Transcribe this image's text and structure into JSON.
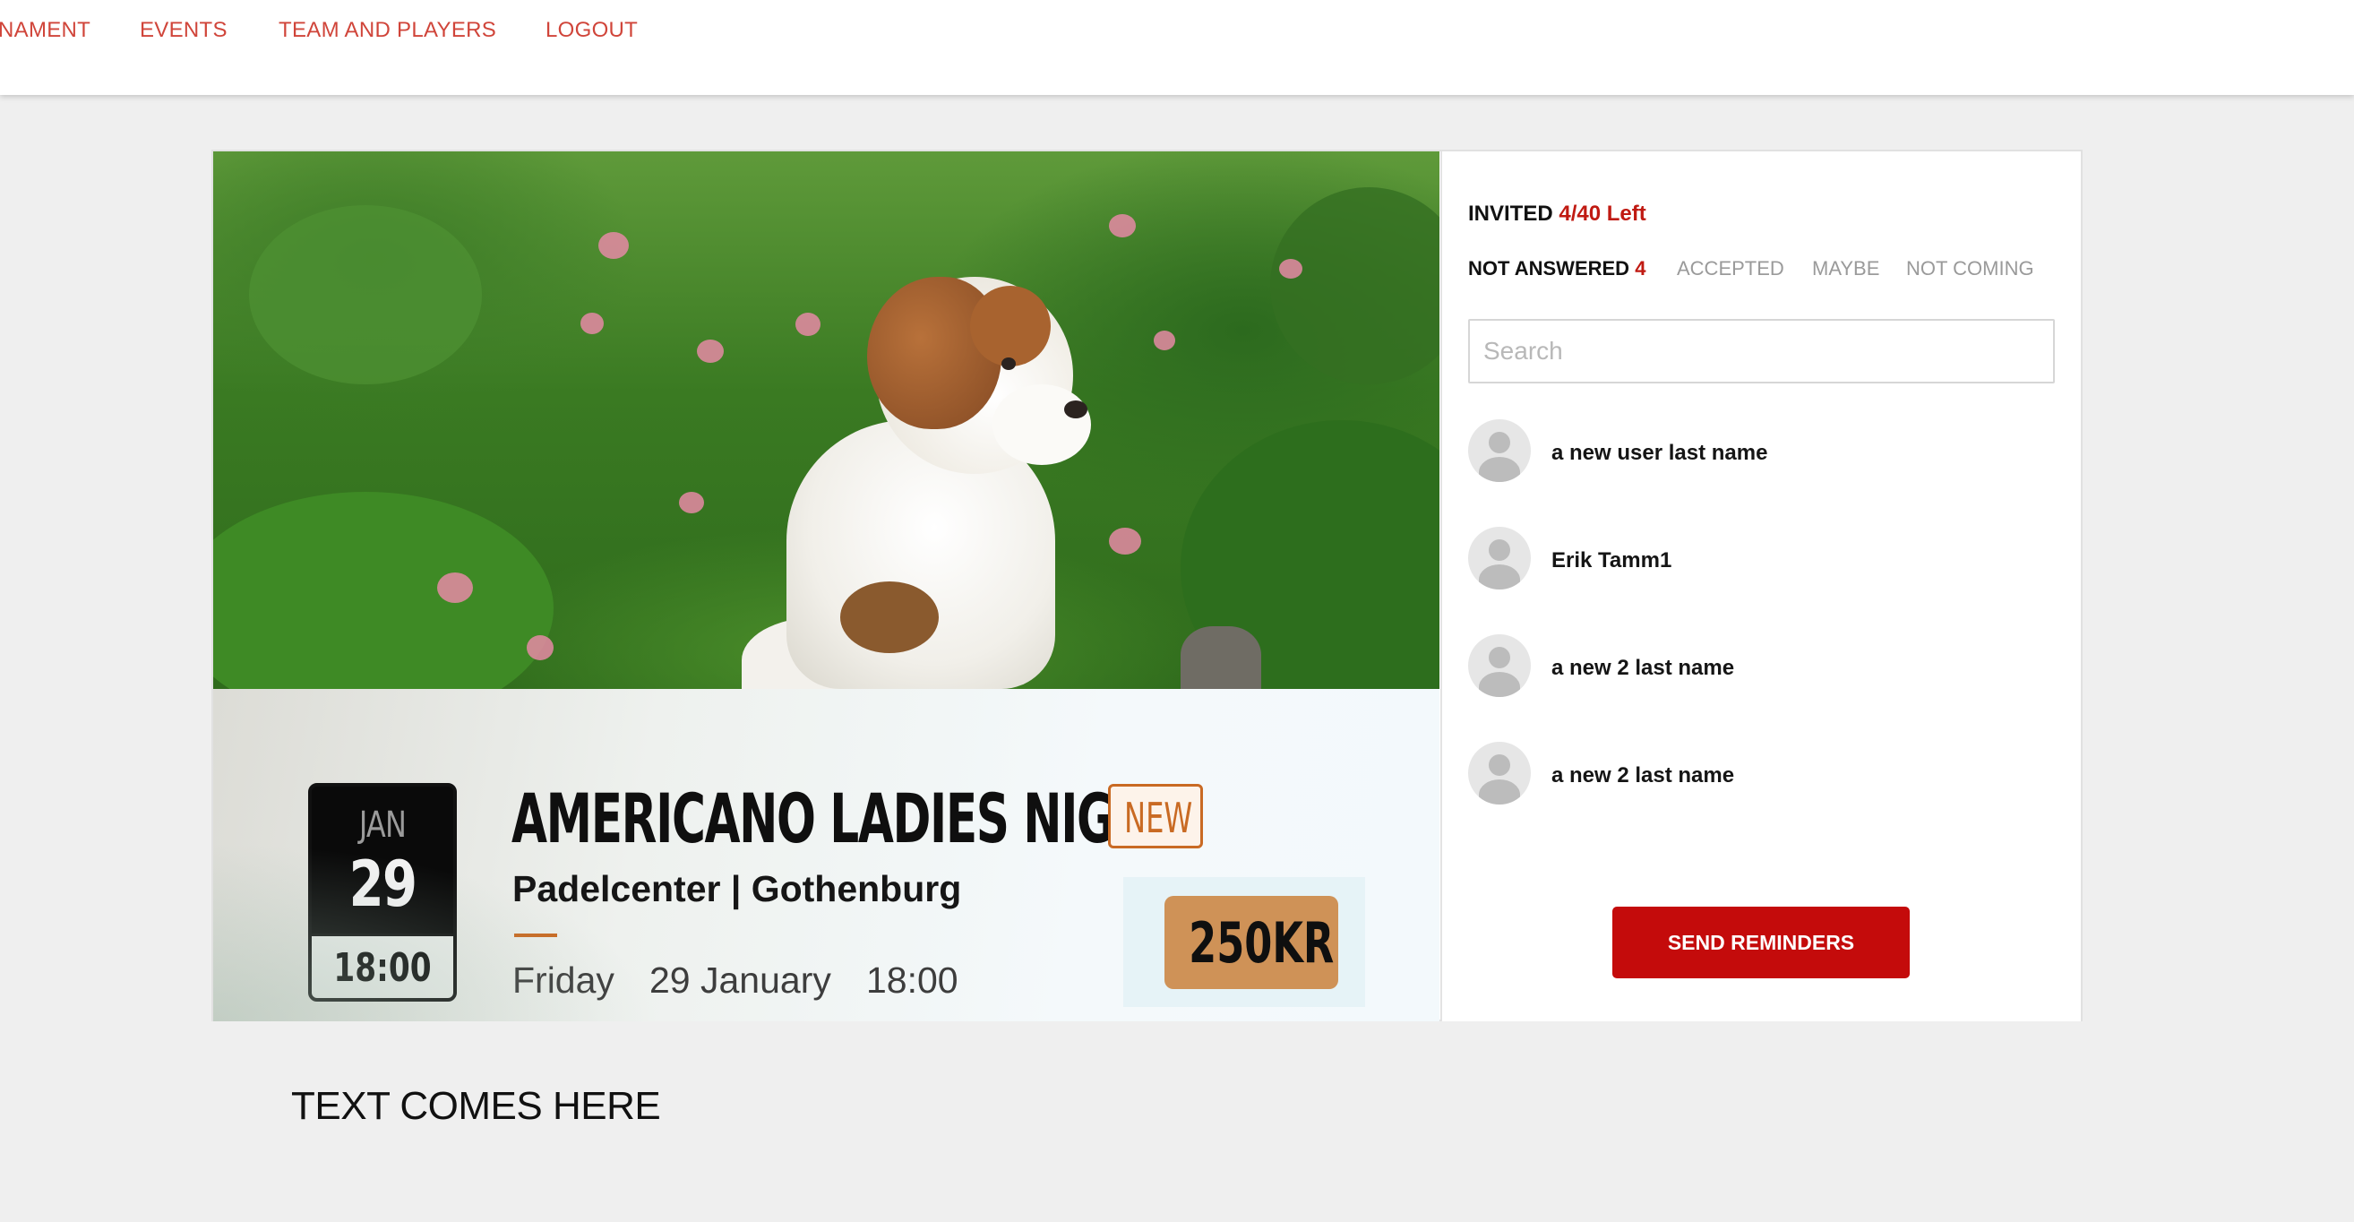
{
  "nav": {
    "items": [
      {
        "label": "NAMENT"
      },
      {
        "label": "EVENTS"
      },
      {
        "label": "TEAM AND PLAYERS"
      },
      {
        "label": "LOGOUT"
      }
    ]
  },
  "event": {
    "date_month": "JAN",
    "date_day": "29",
    "date_time": "18:00",
    "title": "AMERICANO LADIES NIGHT",
    "badge": "NEW",
    "venue": "Padelcenter | Gothenburg",
    "weekday": "Friday",
    "date_long": "29 January",
    "time": "18:00",
    "price": "250KR"
  },
  "invites": {
    "label": "INVITED",
    "left_count": "4/40 Left",
    "tabs": [
      {
        "label": "NOT ANSWERED",
        "count": "4"
      },
      {
        "label": "ACCEPTED"
      },
      {
        "label": "MAYBE"
      },
      {
        "label": "NOT COMING"
      }
    ],
    "search_placeholder": "Search",
    "people": [
      {
        "name": "a new user last name"
      },
      {
        "name": "Erik Tamm1"
      },
      {
        "name": "a new 2 last name"
      },
      {
        "name": "a new 2 last name"
      }
    ],
    "send_label": "SEND REMINDERS"
  },
  "footer": {
    "text": "TEXT COMES HERE"
  },
  "colors": {
    "nav_link": "#d0453a",
    "accent_red": "#c01a12",
    "button_red": "#c40b0b",
    "badge_orange": "#c96a23",
    "price_bg": "#cf9257"
  },
  "icons": {
    "avatar": "user-avatar-icon"
  }
}
